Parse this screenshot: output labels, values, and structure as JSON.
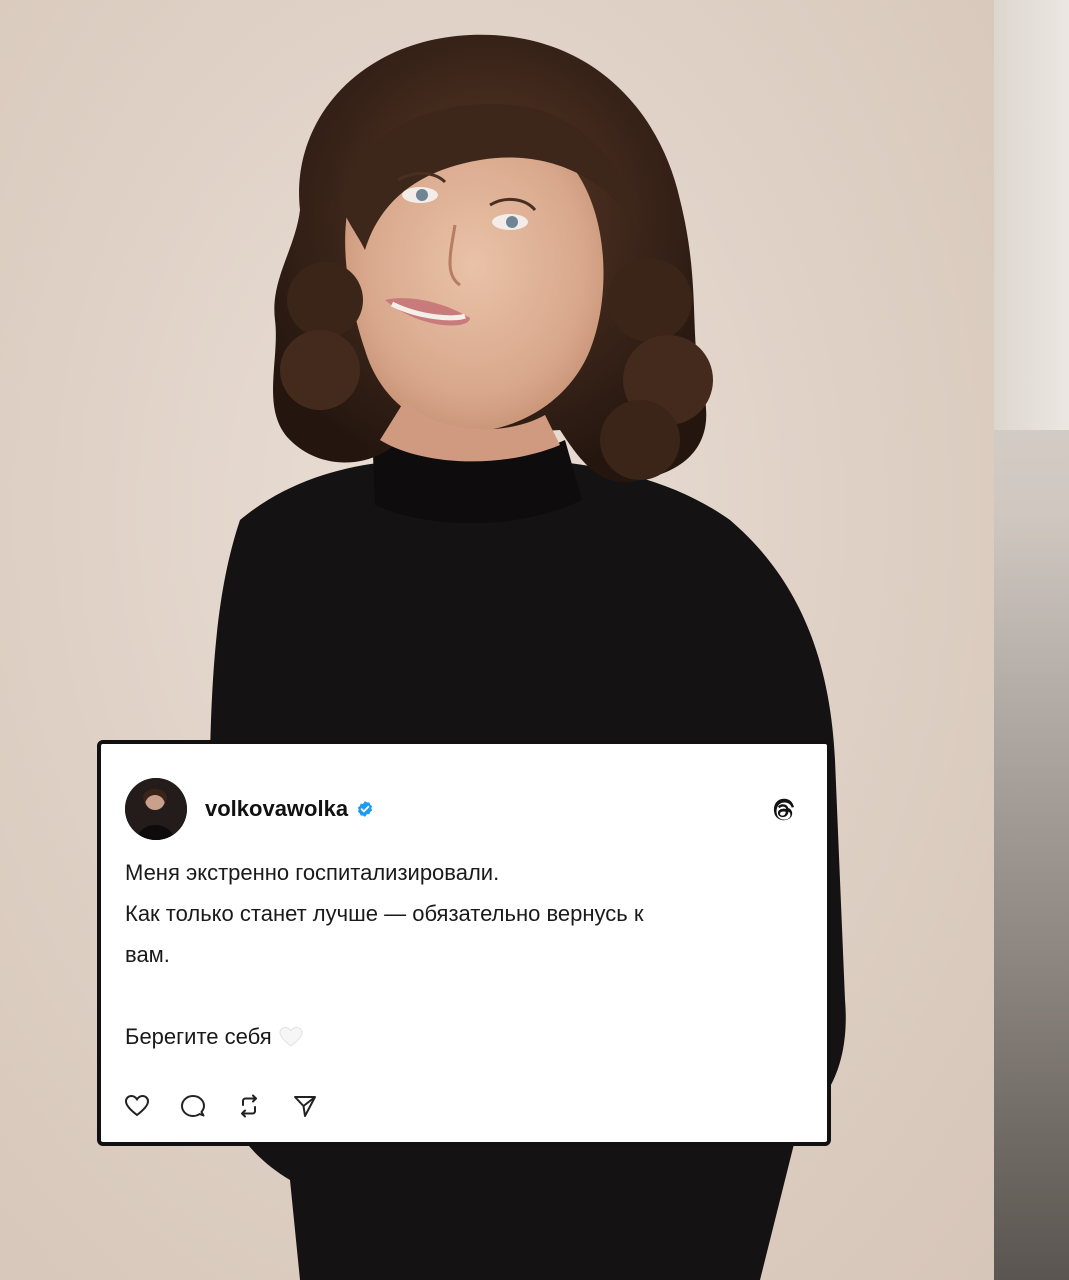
{
  "post": {
    "username": "volkovawolka",
    "verified_icon": "verified-badge-icon",
    "platform_icon": "threads-icon",
    "text_lines": [
      "Меня экстренно госпитализировали.",
      "Как только станет лучше — обязательно вернусь к",
      "вам.",
      "",
      "Берегите себя"
    ],
    "emoji": "white-heart-icon",
    "actions": [
      "heart-icon",
      "comment-icon",
      "repost-icon",
      "share-icon"
    ]
  },
  "colors": {
    "verified": "#1d9bf0",
    "card_border": "#111111",
    "card_bg": "#ffffff",
    "text": "#1a1a1a"
  }
}
